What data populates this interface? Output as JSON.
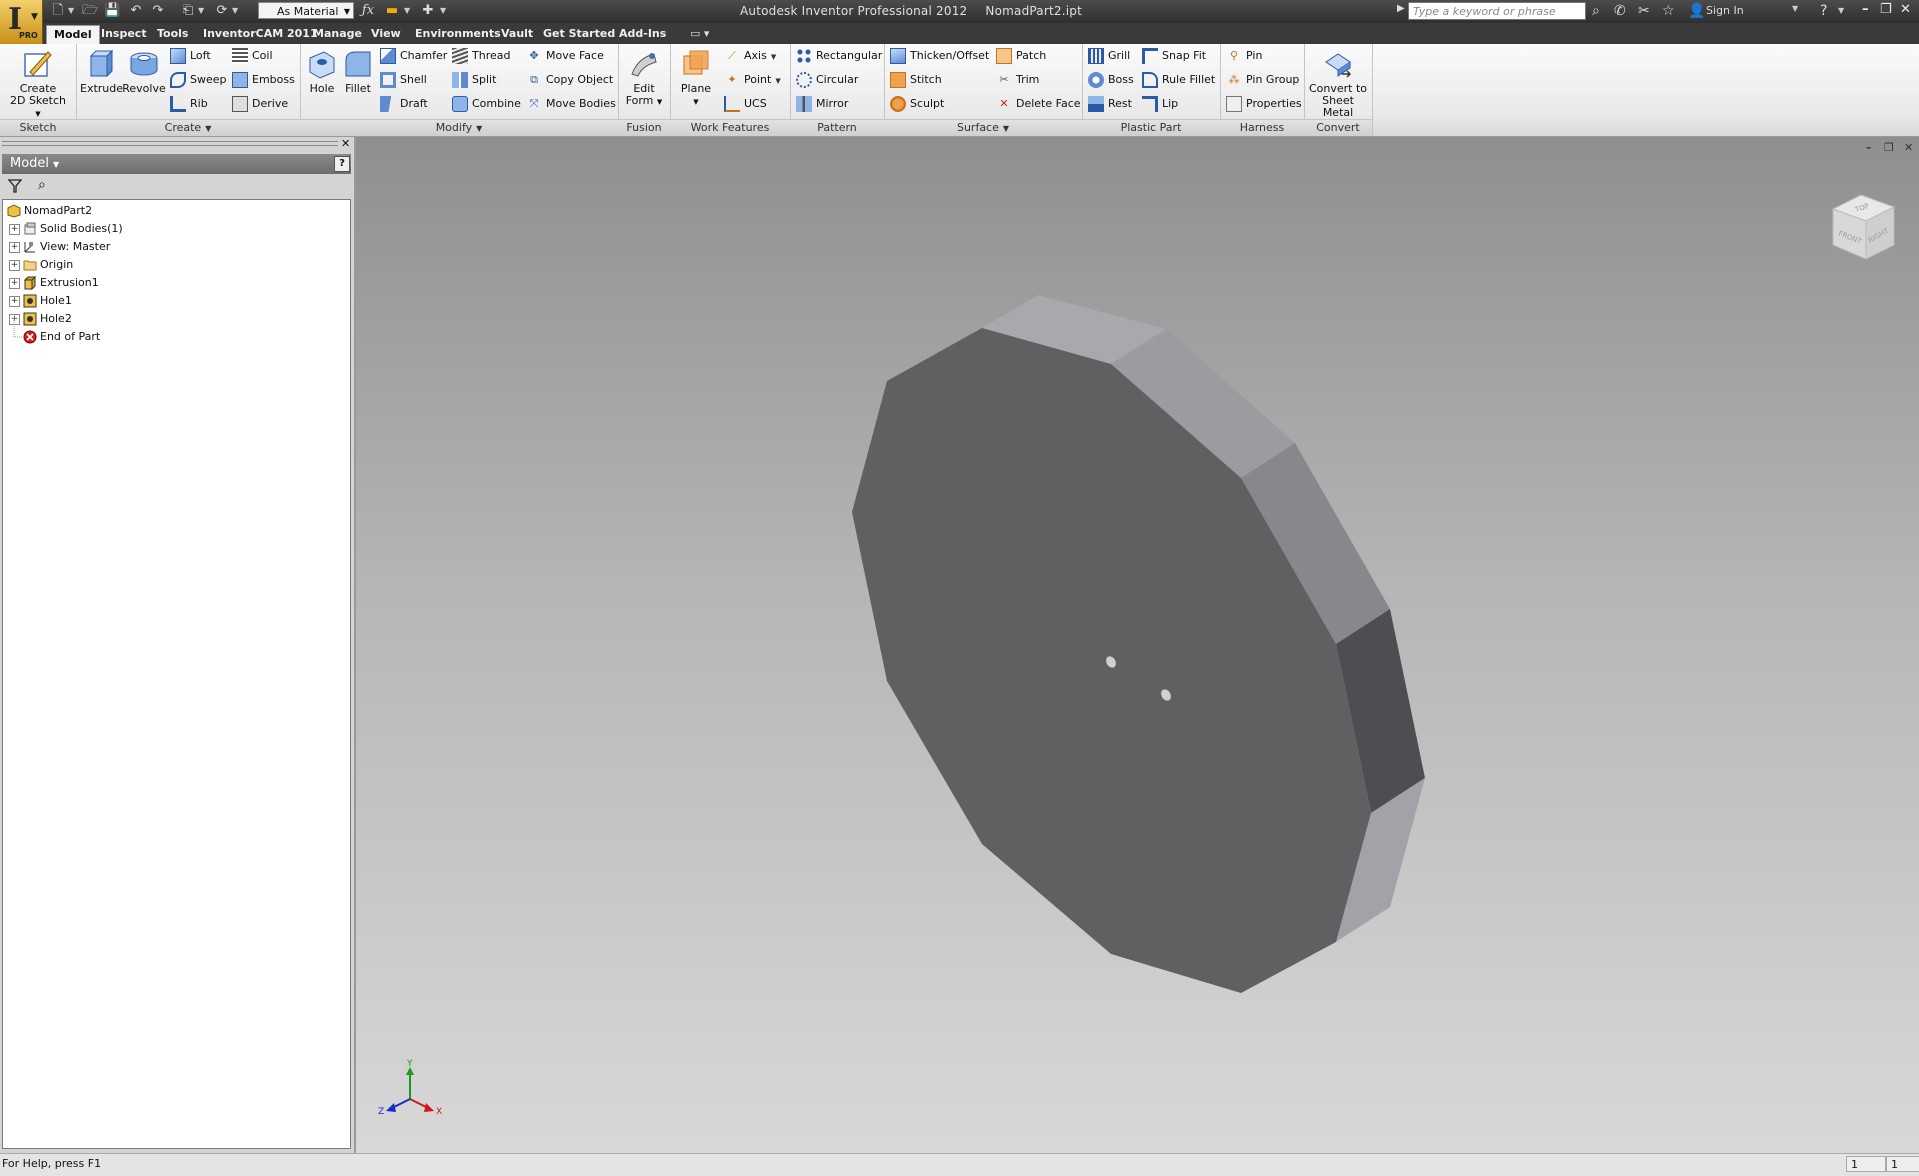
{
  "window": {
    "app_title": "Autodesk Inventor Professional 2012",
    "file_name": "NomadPart2.ipt",
    "app_badge": "PRO",
    "material": "As Material",
    "search_placeholder": "Type a keyword or phrase",
    "sign_in": "Sign In"
  },
  "tabs": [
    "Model",
    "Inspect",
    "Tools",
    "InventorCAM 2011",
    "Manage",
    "View",
    "Environments",
    "Vault",
    "Get Started",
    "Add-Ins"
  ],
  "ribbon": {
    "sketch": {
      "title": "Sketch",
      "create_2d_sketch": [
        "Create",
        "2D Sketch"
      ]
    },
    "create": {
      "title": "Create",
      "extrude": "Extrude",
      "revolve": "Revolve",
      "loft": "Loft",
      "sweep": "Sweep",
      "rib": "Rib",
      "coil": "Coil",
      "emboss": "Emboss",
      "derive": "Derive"
    },
    "modify": {
      "title": "Modify",
      "hole": "Hole",
      "fillet": "Fillet",
      "chamfer": "Chamfer",
      "shell": "Shell",
      "draft": "Draft",
      "thread": "Thread",
      "split": "Split",
      "combine": "Combine",
      "move_face": "Move Face",
      "copy_object": "Copy Object",
      "move_bodies": "Move Bodies"
    },
    "fusion": {
      "title": "Fusion",
      "edit_form": [
        "Edit",
        "Form"
      ]
    },
    "work_features": {
      "title": "Work Features",
      "plane": "Plane",
      "axis": "Axis",
      "point": "Point",
      "ucs": "UCS"
    },
    "pattern": {
      "title": "Pattern",
      "rectangular": "Rectangular",
      "circular": "Circular",
      "mirror": "Mirror"
    },
    "surface": {
      "title": "Surface",
      "thicken_offset": "Thicken/Offset",
      "stitch": "Stitch",
      "sculpt": "Sculpt",
      "patch": "Patch",
      "trim": "Trim",
      "delete_face": "Delete Face"
    },
    "plastic_part": {
      "title": "Plastic Part",
      "grill": "Grill",
      "boss": "Boss",
      "rest": "Rest",
      "snap_fit": "Snap Fit",
      "rule_fillet": "Rule Fillet",
      "lip": "Lip"
    },
    "harness": {
      "title": "Harness",
      "pin": "Pin",
      "pin_group": "Pin Group",
      "properties": "Properties"
    },
    "convert": {
      "title": "Convert",
      "convert_to_sheet_metal": [
        "Convert to",
        "Sheet Metal"
      ]
    }
  },
  "browser": {
    "title": "Model",
    "help": "?",
    "tree": [
      {
        "label": "NomadPart2",
        "icon": "part-icon",
        "expandable": false
      },
      {
        "label": "Solid Bodies(1)",
        "icon": "solid-bodies-icon",
        "expandable": true
      },
      {
        "label": "View: Master",
        "icon": "view-icon",
        "expandable": true
      },
      {
        "label": "Origin",
        "icon": "folder-icon",
        "expandable": true
      },
      {
        "label": "Extrusion1",
        "icon": "extrusion-icon",
        "expandable": true
      },
      {
        "label": "Hole1",
        "icon": "hole-icon",
        "expandable": true
      },
      {
        "label": "Hole2",
        "icon": "hole-icon",
        "expandable": true
      },
      {
        "label": "End of Part",
        "icon": "end-of-part-icon",
        "expandable": false
      }
    ]
  },
  "viewcube": {
    "top": "TOP",
    "front": "FRONT",
    "right": "RIGHT"
  },
  "triad": {
    "x": "X",
    "y": "Y",
    "z": "Z",
    "x_color": "#cc1a1a",
    "y_color": "#1a9a1a",
    "z_color": "#1a2acc"
  },
  "status": {
    "help_text": "For Help, press F1",
    "cell1": "1",
    "cell2": "1"
  }
}
